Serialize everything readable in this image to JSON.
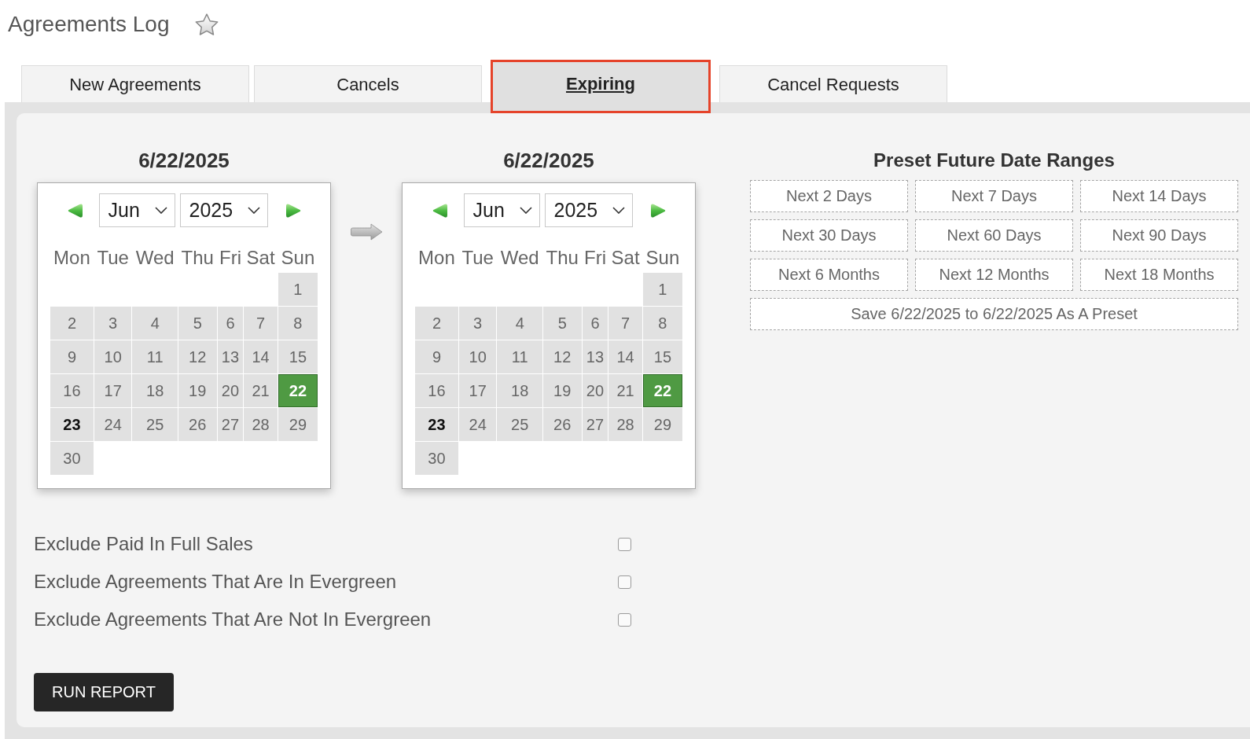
{
  "page": {
    "title": "Agreements Log",
    "starred": false
  },
  "tabs": [
    {
      "label": "New Agreements",
      "selected": false
    },
    {
      "label": "Cancels",
      "selected": false
    },
    {
      "label": "Expiring",
      "selected": true
    },
    {
      "label": "Cancel Requests",
      "selected": false
    }
  ],
  "calendars": [
    {
      "heading": "6/22/2025",
      "month": "Jun",
      "year": "2025",
      "weekdays": [
        "Mon",
        "Tue",
        "Wed",
        "Thu",
        "Fri",
        "Sat",
        "Sun"
      ],
      "weeks": [
        {
          "days": [
            {
              "label": "1",
              "selected": false,
              "today": false
            }
          ]
        },
        {
          "days": [
            {
              "label": "2",
              "selected": false,
              "today": false
            },
            {
              "label": "3",
              "selected": false,
              "today": false
            },
            {
              "label": "4",
              "selected": false,
              "today": false
            },
            {
              "label": "5",
              "selected": false,
              "today": false
            },
            {
              "label": "6",
              "selected": false,
              "today": false
            },
            {
              "label": "7",
              "selected": false,
              "today": false
            },
            {
              "label": "8",
              "selected": false,
              "today": false
            }
          ]
        },
        {
          "days": [
            {
              "label": "9",
              "selected": false,
              "today": false
            },
            {
              "label": "10",
              "selected": false,
              "today": false
            },
            {
              "label": "11",
              "selected": false,
              "today": false
            },
            {
              "label": "12",
              "selected": false,
              "today": false
            },
            {
              "label": "13",
              "selected": false,
              "today": false
            },
            {
              "label": "14",
              "selected": false,
              "today": false
            },
            {
              "label": "15",
              "selected": false,
              "today": false
            }
          ]
        },
        {
          "days": [
            {
              "label": "16",
              "selected": false,
              "today": false
            },
            {
              "label": "17",
              "selected": false,
              "today": false
            },
            {
              "label": "18",
              "selected": false,
              "today": false
            },
            {
              "label": "19",
              "selected": false,
              "today": false
            },
            {
              "label": "20",
              "selected": false,
              "today": false
            },
            {
              "label": "21",
              "selected": false,
              "today": false
            },
            {
              "label": "22",
              "selected": true,
              "today": false
            }
          ]
        },
        {
          "days": [
            {
              "label": "23",
              "selected": false,
              "today": true
            },
            {
              "label": "24",
              "selected": false,
              "today": false
            },
            {
              "label": "25",
              "selected": false,
              "today": false
            },
            {
              "label": "26",
              "selected": false,
              "today": false
            },
            {
              "label": "27",
              "selected": false,
              "today": false
            },
            {
              "label": "28",
              "selected": false,
              "today": false
            },
            {
              "label": "29",
              "selected": false,
              "today": false
            }
          ]
        },
        {
          "days": [
            {
              "label": "30",
              "selected": false,
              "today": false
            }
          ]
        }
      ]
    },
    {
      "heading": "6/22/2025",
      "month": "Jun",
      "year": "2025",
      "weekdays": [
        "Mon",
        "Tue",
        "Wed",
        "Thu",
        "Fri",
        "Sat",
        "Sun"
      ],
      "weeks": [
        {
          "days": [
            {
              "label": "1",
              "selected": false,
              "today": false
            }
          ]
        },
        {
          "days": [
            {
              "label": "2",
              "selected": false,
              "today": false
            },
            {
              "label": "3",
              "selected": false,
              "today": false
            },
            {
              "label": "4",
              "selected": false,
              "today": false
            },
            {
              "label": "5",
              "selected": false,
              "today": false
            },
            {
              "label": "6",
              "selected": false,
              "today": false
            },
            {
              "label": "7",
              "selected": false,
              "today": false
            },
            {
              "label": "8",
              "selected": false,
              "today": false
            }
          ]
        },
        {
          "days": [
            {
              "label": "9",
              "selected": false,
              "today": false
            },
            {
              "label": "10",
              "selected": false,
              "today": false
            },
            {
              "label": "11",
              "selected": false,
              "today": false
            },
            {
              "label": "12",
              "selected": false,
              "today": false
            },
            {
              "label": "13",
              "selected": false,
              "today": false
            },
            {
              "label": "14",
              "selected": false,
              "today": false
            },
            {
              "label": "15",
              "selected": false,
              "today": false
            }
          ]
        },
        {
          "days": [
            {
              "label": "16",
              "selected": false,
              "today": false
            },
            {
              "label": "17",
              "selected": false,
              "today": false
            },
            {
              "label": "18",
              "selected": false,
              "today": false
            },
            {
              "label": "19",
              "selected": false,
              "today": false
            },
            {
              "label": "20",
              "selected": false,
              "today": false
            },
            {
              "label": "21",
              "selected": false,
              "today": false
            },
            {
              "label": "22",
              "selected": true,
              "today": false
            }
          ]
        },
        {
          "days": [
            {
              "label": "23",
              "selected": false,
              "today": true
            },
            {
              "label": "24",
              "selected": false,
              "today": false
            },
            {
              "label": "25",
              "selected": false,
              "today": false
            },
            {
              "label": "26",
              "selected": false,
              "today": false
            },
            {
              "label": "27",
              "selected": false,
              "today": false
            },
            {
              "label": "28",
              "selected": false,
              "today": false
            },
            {
              "label": "29",
              "selected": false,
              "today": false
            }
          ]
        },
        {
          "days": [
            {
              "label": "30",
              "selected": false,
              "today": false
            }
          ]
        }
      ]
    }
  ],
  "presets": {
    "heading": "Preset Future Date Ranges",
    "buttons": [
      "Next 2 Days",
      "Next 7 Days",
      "Next 14 Days",
      "Next 30 Days",
      "Next 60 Days",
      "Next 90 Days",
      "Next 6 Months",
      "Next 12 Months",
      "Next 18 Months"
    ],
    "save_button": "Save 6/22/2025 to 6/22/2025 As A Preset"
  },
  "options": [
    {
      "label": "Exclude Paid In Full Sales",
      "checked": false
    },
    {
      "label": "Exclude Agreements That Are In Evergreen",
      "checked": false
    },
    {
      "label": "Exclude Agreements That Are Not In Evergreen",
      "checked": false
    }
  ],
  "run_button": "RUN REPORT"
}
